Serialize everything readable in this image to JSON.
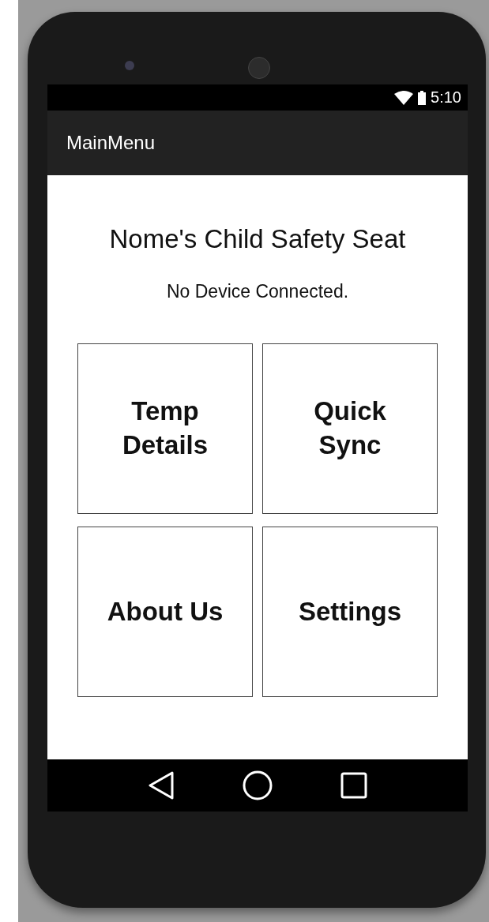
{
  "status_bar": {
    "time": "5:10"
  },
  "app_bar": {
    "title": "MainMenu"
  },
  "content": {
    "heading": "Nome's Child Safety Seat",
    "status": "No Device Connected."
  },
  "tiles": [
    {
      "label": "Temp\nDetails"
    },
    {
      "label": "Quick\nSync"
    },
    {
      "label": "About Us"
    },
    {
      "label": "Settings"
    }
  ]
}
